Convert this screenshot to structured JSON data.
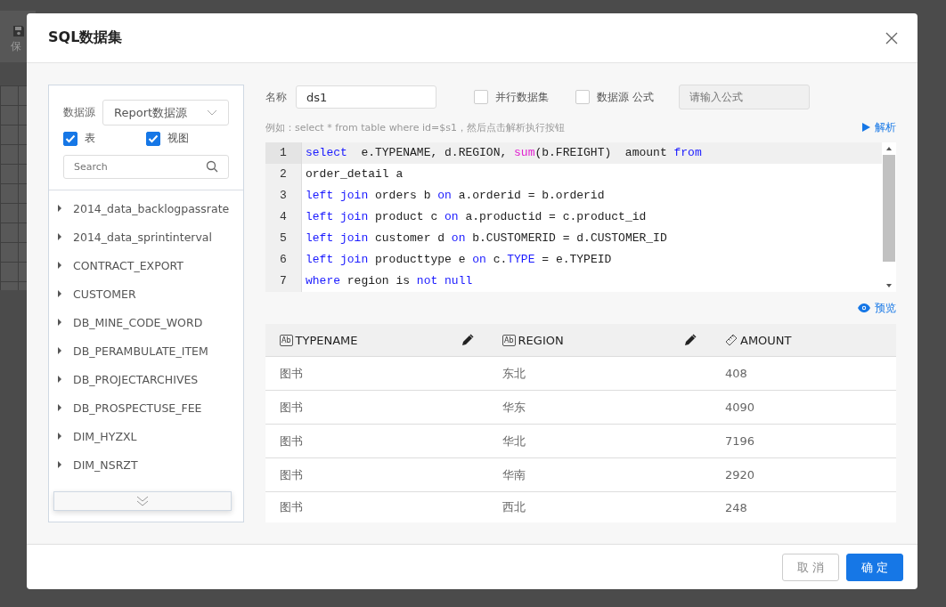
{
  "background": {
    "toolbar_label": "保"
  },
  "dialog": {
    "title": "SQL数据集"
  },
  "source_panel": {
    "label": "数据源",
    "select_value": "Report数据源",
    "filters": [
      {
        "label": "表",
        "checked": true
      },
      {
        "label": "视图",
        "checked": true
      }
    ],
    "search": {
      "placeholder": "Search"
    },
    "tables": [
      {
        "name": "2014_data_backlogpassrate",
        "expanded": false
      },
      {
        "name": "2014_data_sprintinterval",
        "expanded": false
      },
      {
        "name": "CONTRACT_EXPORT",
        "expanded": false
      },
      {
        "name": "CUSTOMER",
        "expanded": false
      },
      {
        "name": "DB_MINE_CODE_WORD",
        "expanded": false
      },
      {
        "name": "DB_PERAMBULATE_ITEM",
        "expanded": false
      },
      {
        "name": "DB_PROJECTARCHIVES",
        "expanded": false
      },
      {
        "name": "DB_PROSPECTUSE_FEE",
        "expanded": false
      },
      {
        "name": "DIM_HYZXL",
        "expanded": false
      },
      {
        "name": "DIM_NSRZT",
        "expanded": false
      }
    ]
  },
  "form": {
    "name_label": "名称",
    "name_value": "ds1",
    "options": [
      {
        "label": "并行数据集",
        "checked": false
      },
      {
        "label": "数据源 公式",
        "checked": false
      }
    ],
    "formula": {
      "placeholder": "请输入公式",
      "disabled": true
    },
    "hint": "例如：select * from table where id=$s1，然后点击解析执行按钮",
    "parse_button": "解析"
  },
  "editor": {
    "lines": [
      {
        "number": "1",
        "active": true,
        "tokens": [
          {
            "text": "select",
            "kind": "keyword"
          },
          {
            "text": "  e.TYPENAME, d.REGION, ",
            "kind": "plain"
          },
          {
            "text": "sum",
            "kind": "function"
          },
          {
            "text": "(b.FREIGHT)  amount ",
            "kind": "plain"
          },
          {
            "text": "from",
            "kind": "keyword"
          }
        ]
      },
      {
        "number": "2",
        "active": false,
        "tokens": [
          {
            "text": "order_detail a",
            "kind": "plain"
          }
        ]
      },
      {
        "number": "3",
        "active": false,
        "tokens": [
          {
            "text": "left join",
            "kind": "keyword"
          },
          {
            "text": " orders b ",
            "kind": "plain"
          },
          {
            "text": "on",
            "kind": "keyword"
          },
          {
            "text": " a.orderid = b.orderid",
            "kind": "plain"
          }
        ]
      },
      {
        "number": "4",
        "active": false,
        "tokens": [
          {
            "text": "left join",
            "kind": "keyword"
          },
          {
            "text": " product c ",
            "kind": "plain"
          },
          {
            "text": "on",
            "kind": "keyword"
          },
          {
            "text": " a.productid = c.product_id",
            "kind": "plain"
          }
        ]
      },
      {
        "number": "5",
        "active": false,
        "tokens": [
          {
            "text": "left join",
            "kind": "keyword"
          },
          {
            "text": " customer d ",
            "kind": "plain"
          },
          {
            "text": "on",
            "kind": "keyword"
          },
          {
            "text": " b.CUSTOMERID = d.CUSTOMER_ID",
            "kind": "plain"
          }
        ]
      },
      {
        "number": "6",
        "active": false,
        "tokens": [
          {
            "text": "left join",
            "kind": "keyword"
          },
          {
            "text": " producttype e ",
            "kind": "plain"
          },
          {
            "text": "on",
            "kind": "keyword"
          },
          {
            "text": " c.",
            "kind": "plain"
          },
          {
            "text": "TYPE",
            "kind": "keyword"
          },
          {
            "text": " = e.TYPEID",
            "kind": "plain"
          }
        ]
      },
      {
        "number": "7",
        "active": false,
        "tokens": [
          {
            "text": "where",
            "kind": "keyword"
          },
          {
            "text": " region is ",
            "kind": "plain"
          },
          {
            "text": "not null",
            "kind": "keyword"
          }
        ]
      }
    ]
  },
  "preview_button": "预览",
  "result_table": {
    "columns": [
      {
        "name": "TYPENAME",
        "kind": "text",
        "badge": "Ab",
        "editable": true
      },
      {
        "name": "REGION",
        "kind": "text",
        "badge": "Ab",
        "editable": true
      },
      {
        "name": "AMOUNT",
        "kind": "number",
        "editable": false
      }
    ],
    "rows": [
      [
        "图书",
        "东北",
        "408"
      ],
      [
        "图书",
        "华东",
        "4090"
      ],
      [
        "图书",
        "华北",
        "7196"
      ],
      [
        "图书",
        "华南",
        "2920"
      ],
      [
        "图书",
        "西北",
        "248"
      ]
    ]
  },
  "buttons": [
    {
      "label": "取 消",
      "primary": false
    },
    {
      "label": "确 定",
      "primary": true
    }
  ]
}
